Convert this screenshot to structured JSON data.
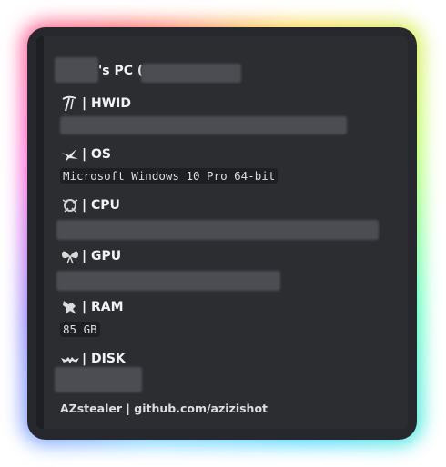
{
  "embed": {
    "title_suffix": "'s PC (",
    "fields": [
      {
        "label": "| HWID",
        "icon": "pickaxe-icon"
      },
      {
        "label": "| OS",
        "value": "Microsoft Windows 10 Pro  64-bit",
        "icon": "bird-icon"
      },
      {
        "label": "| CPU",
        "icon": "creature-icon"
      },
      {
        "label": "| GPU",
        "icon": "butterfly-icon"
      },
      {
        "label": "| RAM",
        "value": "85 GB",
        "icon": "beast-icon"
      },
      {
        "label": "| DISK",
        "icon": "bat-icon"
      }
    ],
    "footer": "AZstealer | github.com/azizishot"
  }
}
